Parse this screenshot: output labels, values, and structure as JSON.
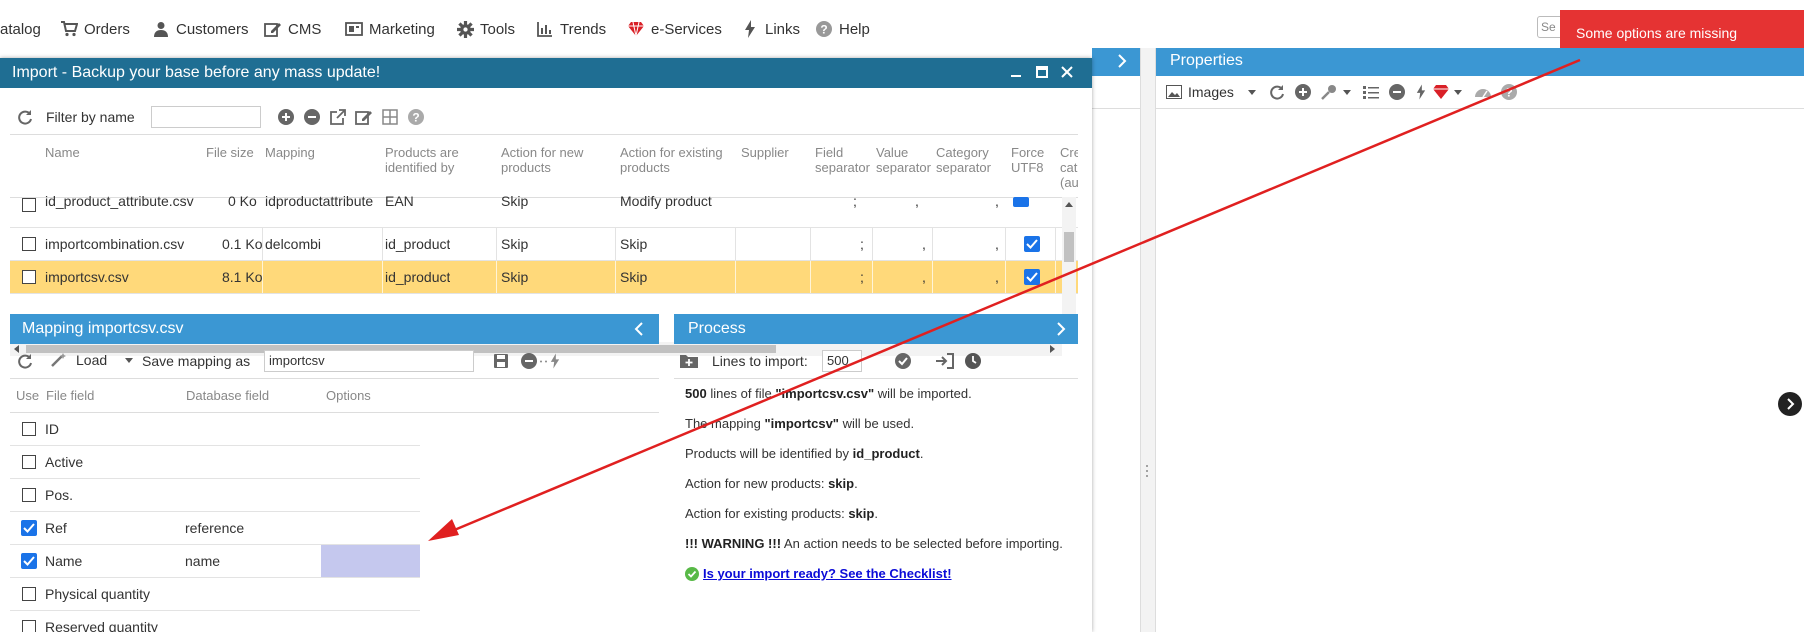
{
  "topmenu": {
    "items": [
      {
        "label": "atalog",
        "icon": "catalog-icon"
      },
      {
        "label": "Orders",
        "icon": "cart-icon"
      },
      {
        "label": "Customers",
        "icon": "user-icon"
      },
      {
        "label": "CMS",
        "icon": "edit-icon"
      },
      {
        "label": "Marketing",
        "icon": "megaphone-icon"
      },
      {
        "label": "Tools",
        "icon": "gear-icon"
      },
      {
        "label": "Trends",
        "icon": "bar-chart-icon"
      },
      {
        "label": "e-Services",
        "icon": "gem-icon"
      },
      {
        "label": "Links",
        "icon": "bolt-icon"
      },
      {
        "label": "Help",
        "icon": "help-icon"
      }
    ],
    "search_placeholder": "Se"
  },
  "alert": {
    "text": "Some options are missing",
    "color": "#e53333"
  },
  "properties": {
    "title": "Properties",
    "images_label": "Images"
  },
  "import_window": {
    "title": "Import - Backup your base before any mass update!"
  },
  "files_toolbar": {
    "filter_label": "Filter by name",
    "filter_value": ""
  },
  "files_grid": {
    "headers": [
      "Name",
      "File size",
      "Mapping",
      "Products are identified by",
      "Action for new products",
      "Action for existing products",
      "Supplier",
      "Field separator",
      "Value separator",
      "Category separator",
      "Force UTF8",
      "Cre cat (au"
    ],
    "rows": [
      {
        "name": "id_product_attribute.csv",
        "size": "0 Ko",
        "mapping": "idproductattribute",
        "identified_by": "EAN",
        "action_new": "Skip",
        "action_existing": "Modify product",
        "supplier": "",
        "field_sep": ";",
        "value_sep": ",",
        "cat_sep": ",",
        "utf8": true,
        "checked": false
      },
      {
        "name": "importcombination.csv",
        "size": "0.1 Ko",
        "mapping": "delcombi",
        "identified_by": "id_product",
        "action_new": "Skip",
        "action_existing": "Skip",
        "supplier": "",
        "field_sep": ";",
        "value_sep": ",",
        "cat_sep": ",",
        "utf8": true,
        "checked": false
      },
      {
        "name": "importcsv.csv",
        "size": "8.1 Ko",
        "mapping": "",
        "identified_by": "id_product",
        "action_new": "Skip",
        "action_existing": "Skip",
        "supplier": "",
        "field_sep": ";",
        "value_sep": ",",
        "cat_sep": ",",
        "utf8": true,
        "checked": false,
        "selected": true
      }
    ]
  },
  "mapping_panel": {
    "title": "Mapping importcsv.csv",
    "load_label": "Load",
    "save_as_label": "Save mapping as",
    "save_as_value": "importcsv",
    "headers": [
      "Use",
      "File field",
      "Database field",
      "Options"
    ],
    "rows": [
      {
        "use": false,
        "field": "ID",
        "db": ""
      },
      {
        "use": false,
        "field": "Active",
        "db": ""
      },
      {
        "use": false,
        "field": "Pos.",
        "db": ""
      },
      {
        "use": true,
        "field": "Ref",
        "db": "reference"
      },
      {
        "use": true,
        "field": "Name",
        "db": "name",
        "options_highlight": true
      },
      {
        "use": false,
        "field": "Physical quantity",
        "db": ""
      },
      {
        "use": false,
        "field": "Reserved quantity",
        "db": ""
      }
    ]
  },
  "process_panel": {
    "title": "Process",
    "lines_label": "Lines to import:",
    "lines_value": "500",
    "messages": [
      {
        "parts": [
          {
            "b": true,
            "t": "500"
          },
          {
            "b": false,
            "t": " lines of file "
          },
          {
            "b": true,
            "t": "\"importcsv.csv\""
          },
          {
            "b": false,
            "t": " will be imported."
          }
        ]
      },
      {
        "parts": [
          {
            "b": false,
            "t": "The mapping "
          },
          {
            "b": true,
            "t": "\"importcsv\""
          },
          {
            "b": false,
            "t": " will be used."
          }
        ]
      },
      {
        "parts": [
          {
            "b": false,
            "t": "Products will be identified by "
          },
          {
            "b": true,
            "t": "id_product"
          },
          {
            "b": false,
            "t": "."
          }
        ]
      },
      {
        "parts": [
          {
            "b": false,
            "t": "Action for new products: "
          },
          {
            "b": true,
            "t": "skip"
          },
          {
            "b": false,
            "t": "."
          }
        ]
      },
      {
        "parts": [
          {
            "b": false,
            "t": "Action for existing products: "
          },
          {
            "b": true,
            "t": "skip"
          },
          {
            "b": false,
            "t": "."
          }
        ]
      },
      {
        "parts": [
          {
            "b": true,
            "t": "!!! WARNING !!!"
          },
          {
            "b": false,
            "t": " An action needs to be selected before importing."
          }
        ]
      }
    ],
    "checklist_link": "Is your import ready? See the Checklist!"
  },
  "colors": {
    "title_bar": "#1f6e93",
    "panel_header": "#3b97d3",
    "selected_row": "#ffd97a",
    "checkbox_on": "#1a73e8",
    "options_highlight": "#c5c8ee",
    "arrow": "#e02020"
  }
}
